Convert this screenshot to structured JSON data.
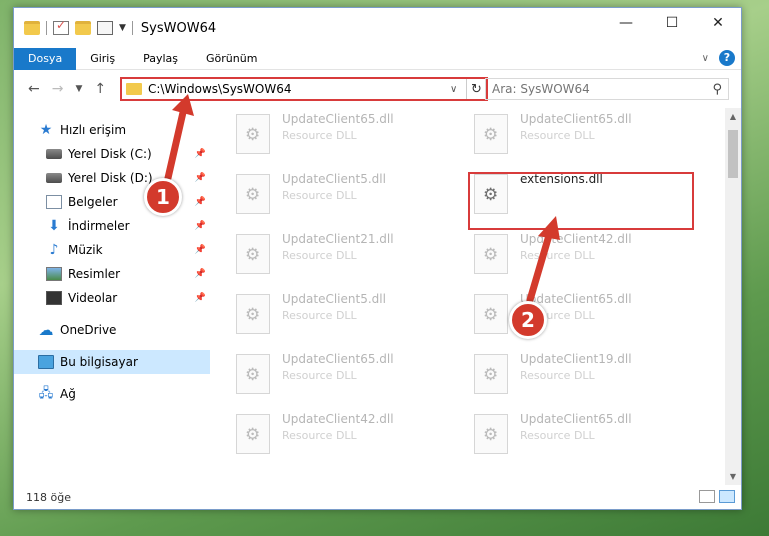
{
  "window": {
    "title": "SysWOW64",
    "controls": {
      "minimize": "—",
      "maximize": "☐",
      "close": "✕"
    }
  },
  "ribbon": {
    "tabs": [
      "Dosya",
      "Giriş",
      "Paylaş",
      "Görünüm"
    ],
    "help": "?"
  },
  "address": {
    "path": "C:\\Windows\\SysWOW64",
    "search_placeholder": "Ara: SysWOW64"
  },
  "sidebar": {
    "items": [
      {
        "label": "Hızlı erişim",
        "icon": "star-icon",
        "indent": false,
        "pinned": false
      },
      {
        "label": "Yerel Disk (C:)",
        "icon": "disk-icon",
        "indent": true,
        "pinned": true
      },
      {
        "label": "Yerel Disk (D:)",
        "icon": "disk-icon",
        "indent": true,
        "pinned": true
      },
      {
        "label": "Belgeler",
        "icon": "documents-icon",
        "indent": true,
        "pinned": true
      },
      {
        "label": "İndirmeler",
        "icon": "download-icon",
        "indent": true,
        "pinned": true
      },
      {
        "label": "Müzik",
        "icon": "music-icon",
        "indent": true,
        "pinned": true
      },
      {
        "label": "Resimler",
        "icon": "pictures-icon",
        "indent": true,
        "pinned": true
      },
      {
        "label": "Videolar",
        "icon": "videos-icon",
        "indent": true,
        "pinned": true
      },
      {
        "label": "OneDrive",
        "icon": "cloud-icon",
        "indent": false,
        "pinned": false
      },
      {
        "label": "Bu bilgisayar",
        "icon": "computer-icon",
        "indent": false,
        "pinned": false,
        "selected": true
      },
      {
        "label": "Ağ",
        "icon": "network-icon",
        "indent": false,
        "pinned": false
      }
    ]
  },
  "files": [
    {
      "name": "UpdateClient65.dll",
      "type": "Resource DLL"
    },
    {
      "name": "UpdateClient65.dll",
      "type": "Resource DLL"
    },
    {
      "name": "UpdateClient5.dll",
      "type": "Resource DLL"
    },
    {
      "name": "extensions.dll",
      "type": "",
      "highlight": true
    },
    {
      "name": "UpdateClient21.dll",
      "type": "Resource DLL"
    },
    {
      "name": "UpdateClient42.dll",
      "type": "Resource DLL"
    },
    {
      "name": "UpdateClient5.dll",
      "type": "Resource DLL"
    },
    {
      "name": "UpdateClient65.dll",
      "type": "Resource DLL"
    },
    {
      "name": "UpdateClient65.dll",
      "type": "Resource DLL"
    },
    {
      "name": "UpdateClient19.dll",
      "type": "Resource DLL"
    },
    {
      "name": "UpdateClient42.dll",
      "type": "Resource DLL"
    },
    {
      "name": "UpdateClient65.dll",
      "type": "Resource DLL"
    }
  ],
  "status": {
    "count": "118 öğe"
  },
  "callouts": [
    "1",
    "2"
  ],
  "colors": {
    "accent": "#1979ca",
    "highlight": "#d83b3b",
    "selection": "#cce8ff"
  }
}
